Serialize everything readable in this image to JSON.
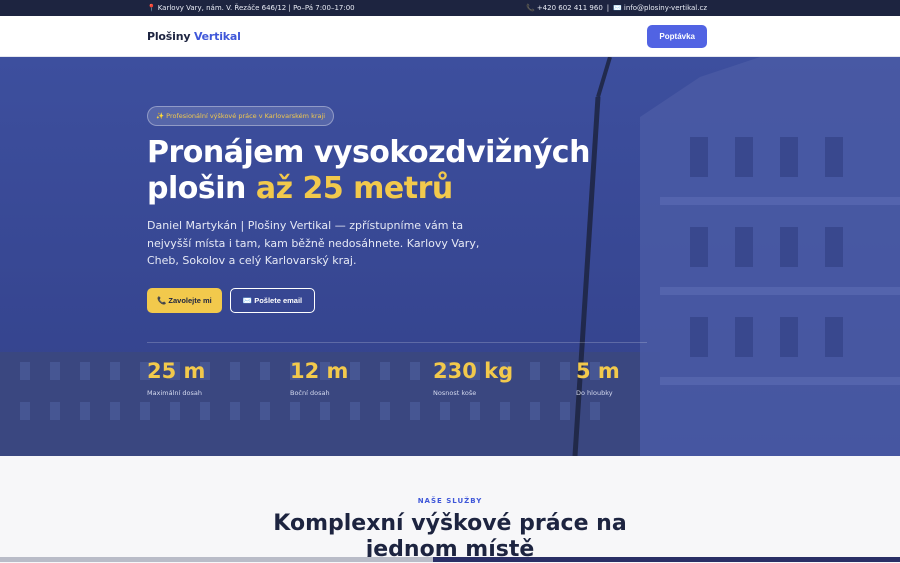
{
  "topbar": {
    "address": "Karlovy Vary, nám. V. Řezáče 646/12 | Po–Pá 7:00–17:00",
    "phone": "+420 602 411 960",
    "separator": "|",
    "email": "info@plosiny-vertikal.cz",
    "address_icon": "pin-icon",
    "phone_icon": "phone-icon",
    "email_icon": "envelope-icon"
  },
  "nav": {
    "logo_part1": "Plošiny",
    "logo_part2": "Vertikal",
    "cta_label": "Poptávka"
  },
  "hero": {
    "badge": "✨ Profesionální výškové práce v Karlovarském kraji",
    "headline_line1": "Pronájem vysokozdvižných",
    "headline_line2_a": "plošin",
    "headline_line2_b": "až 25 metrů",
    "lead": "Daniel Martykán | Plošiny Vertikal — zpřístupníme vám ta nejvyšší místa i tam, kam běžně nedosáhnete. Karlovy Vary, Cheb, Sokolov a celý Karlovarský kraj.",
    "btn_call": "📞 Zavolejte mi",
    "btn_email": "✉️ Pošlete email"
  },
  "stats": [
    {
      "value": "25 m",
      "label": "Maximální dosah"
    },
    {
      "value": "12 m",
      "label": "Boční dosah"
    },
    {
      "value": "230 kg",
      "label": "Nosnost koše"
    },
    {
      "value": "5 m",
      "label": "Do hloubky"
    }
  ],
  "services": {
    "kicker": "NAŠE SLUŽBY",
    "title_line1": "Komplexní výškové práce na",
    "title_line2": "jednom místě"
  },
  "colors": {
    "primary": "#3f57d9",
    "gold": "#f2c94c",
    "dark": "#1d2440",
    "hero_overlay": "#3a4b97"
  }
}
